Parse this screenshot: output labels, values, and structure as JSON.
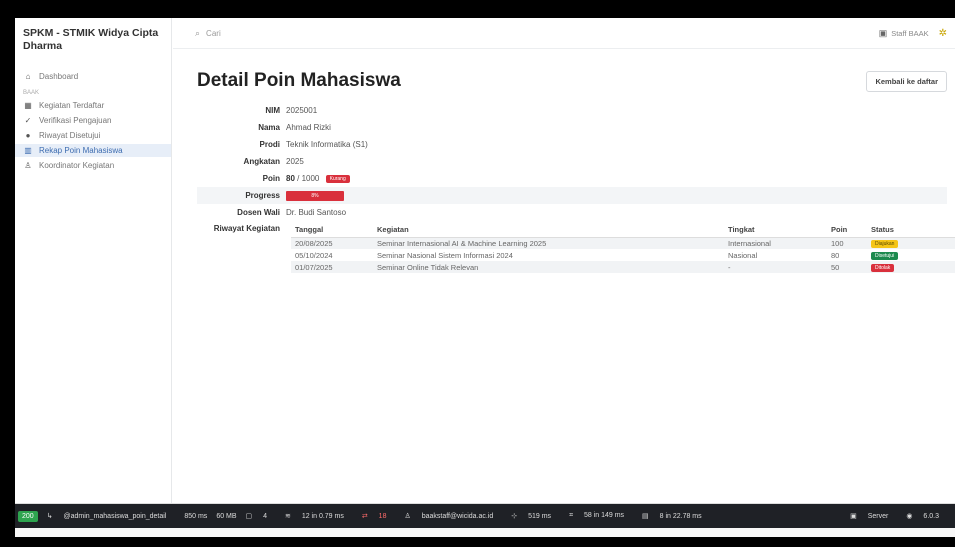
{
  "app": {
    "brand": "SPKM - STMIK Widya Cipta Dharma"
  },
  "topbar": {
    "search_placeholder": "Cari",
    "user": "Staff BAAK"
  },
  "sidebar": {
    "section": "BAAK",
    "dashboard": "Dashboard",
    "items": [
      {
        "label": "Kegiatan Terdaftar",
        "icon": "grid-icon"
      },
      {
        "label": "Verifikasi Pengajuan",
        "icon": "check-icon"
      },
      {
        "label": "Riwayat Disetujui",
        "icon": "circle-icon"
      },
      {
        "label": "Rekap Poin Mahasiswa",
        "icon": "chart-icon",
        "active": true
      },
      {
        "label": "Koordinator Kegiatan",
        "icon": "user-icon"
      }
    ]
  },
  "page": {
    "title": "Detail Poin Mahasiswa",
    "back_button": "Kembali ke daftar",
    "fields": {
      "nim_label": "NIM",
      "nim": "2025001",
      "nama_label": "Nama",
      "nama": "Ahmad Rizki",
      "prodi_label": "Prodi",
      "prodi": "Teknik Informatika (S1)",
      "angkatan_label": "Angkatan",
      "angkatan": "2025",
      "poin_label": "Poin",
      "poin_value": "80",
      "poin_total": "/ 1000",
      "poin_badge": "Kurang",
      "progress_label": "Progress",
      "progress_percent": 8,
      "progress_text": "8%",
      "dosen_label": "Dosen Wali",
      "dosen": "Dr. Budi Santoso",
      "riwayat_label": "Riwayat Kegiatan"
    },
    "table": {
      "headers": [
        "Tanggal",
        "Kegiatan",
        "Tingkat",
        "Poin",
        "Status"
      ],
      "rows": [
        {
          "tanggal": "20/08/2025",
          "kegiatan": "Seminar Internasional AI & Machine Learning 2025",
          "tingkat": "Internasional",
          "poin": "100",
          "status": "Diajukan",
          "status_color": "#f5c518"
        },
        {
          "tanggal": "05/10/2024",
          "kegiatan": "Seminar Nasional Sistem Informasi 2024",
          "tingkat": "Nasional",
          "poin": "80",
          "status": "Disetujui",
          "status_color": "#1d8a4e"
        },
        {
          "tanggal": "01/07/2025",
          "kegiatan": "Seminar Online Tidak Relevan",
          "tingkat": "-",
          "poin": "50",
          "status": "Ditolak",
          "status_color": "#d9303c"
        }
      ]
    }
  },
  "debugbar": {
    "code": "200",
    "route": "@admin_mahasiswa_poin_detail",
    "time": "850 ms",
    "memory": "60 MB",
    "forms": "4",
    "cache": "12 in 0.79 ms",
    "queries": "18",
    "user": "baakstaff@wicida.ac.id",
    "logs": "519 ms",
    "twig": "58 in 149 ms",
    "db": "8 in 22.78 ms",
    "symfony": "6.0.3",
    "server": "Server"
  }
}
